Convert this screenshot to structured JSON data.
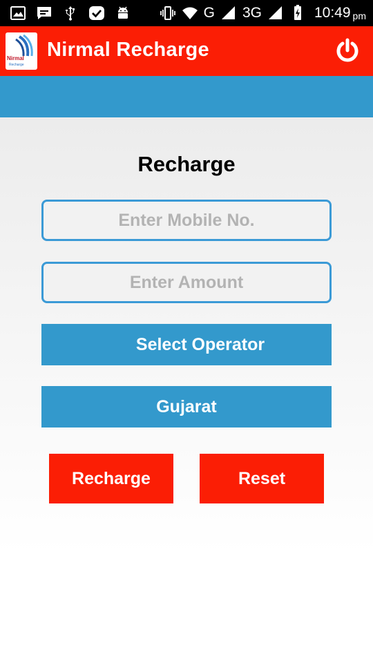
{
  "status_bar": {
    "network_label": "G",
    "network2_label": "3G",
    "time": "10:49",
    "ampm": "pm",
    "left_icons": [
      "image-icon",
      "message-icon",
      "usb-icon",
      "check-badge-icon",
      "android-icon"
    ],
    "right_icons": [
      "vibrate-icon",
      "wifi-icon",
      "signal-icon",
      "signal-icon",
      "battery-charging-icon"
    ]
  },
  "app_bar": {
    "title": "Nirmal Recharge",
    "logo_text": "Nirmal",
    "logo_subtext": "Recharge",
    "background": "#fb1e05",
    "power_icon": "power-icon"
  },
  "form": {
    "heading": "Recharge",
    "mobile_placeholder": "Enter Mobile No.",
    "mobile_value": "",
    "amount_placeholder": "Enter Amount",
    "amount_value": "",
    "operator_label": "Select Operator",
    "circle_label": "Gujarat",
    "recharge_label": "Recharge",
    "reset_label": "Reset"
  },
  "colors": {
    "accent_red": "#fb1e05",
    "accent_blue": "#3399cc",
    "field_border": "#3b9ad6"
  }
}
